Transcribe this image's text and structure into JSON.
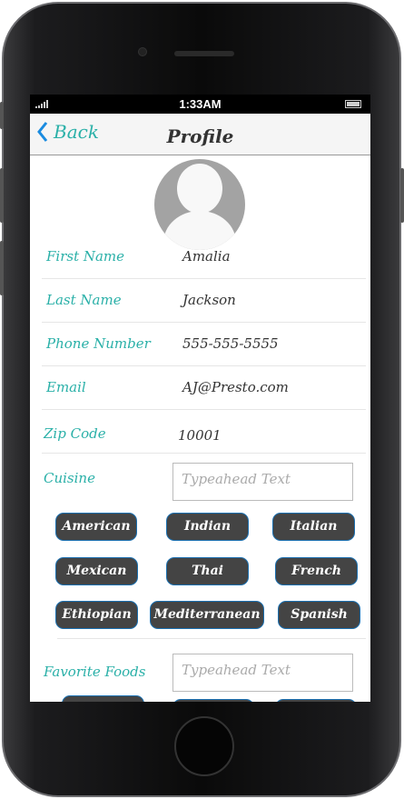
{
  "status": {
    "time": "1:33AM"
  },
  "nav": {
    "back": "Back",
    "title": "Profile"
  },
  "fields": [
    {
      "label": "First Name",
      "value": "Amalia"
    },
    {
      "label": "Last Name",
      "value": "Jackson"
    },
    {
      "label": "Phone Number",
      "value": "555-555-5555"
    },
    {
      "label": "Email",
      "value": "AJ@Presto.com"
    },
    {
      "label": "Zip Code",
      "value": "10001"
    }
  ],
  "cuisine": {
    "label": "Cuisine",
    "placeholder": "Typeahead Text",
    "chips": [
      "American",
      "Indian",
      "Italian",
      "Mexican",
      "Thai",
      "French",
      "Ethiopian",
      "Mediterranean",
      "Spanish"
    ]
  },
  "favorite_foods": {
    "label": "Favorite Foods",
    "placeholder": "Typeahead Text"
  }
}
